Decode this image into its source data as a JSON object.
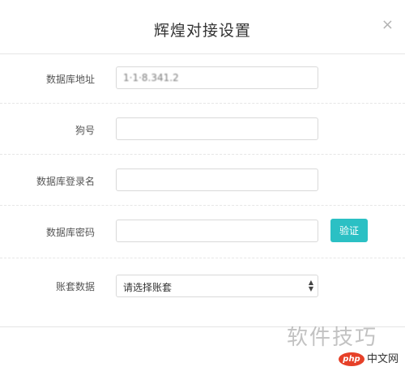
{
  "modal": {
    "title": "辉煌对接设置",
    "close_glyph": "×"
  },
  "form": {
    "db_address": {
      "label": "数据库地址",
      "value": "1·1·8.341.2"
    },
    "dog_number": {
      "label": "狗号",
      "value": ""
    },
    "db_login": {
      "label": "数据库登录名",
      "value": ""
    },
    "db_password": {
      "label": "数据库密码",
      "value": ""
    },
    "verify_button": "验证",
    "account_set": {
      "label": "账套数据",
      "selected": "请选择账套"
    }
  },
  "watermark": {
    "text": "软件技巧",
    "logo_mark": "php",
    "logo_text": "中文网"
  },
  "colors": {
    "accent": "#2bc0c4",
    "logo_red": "#e64028"
  }
}
